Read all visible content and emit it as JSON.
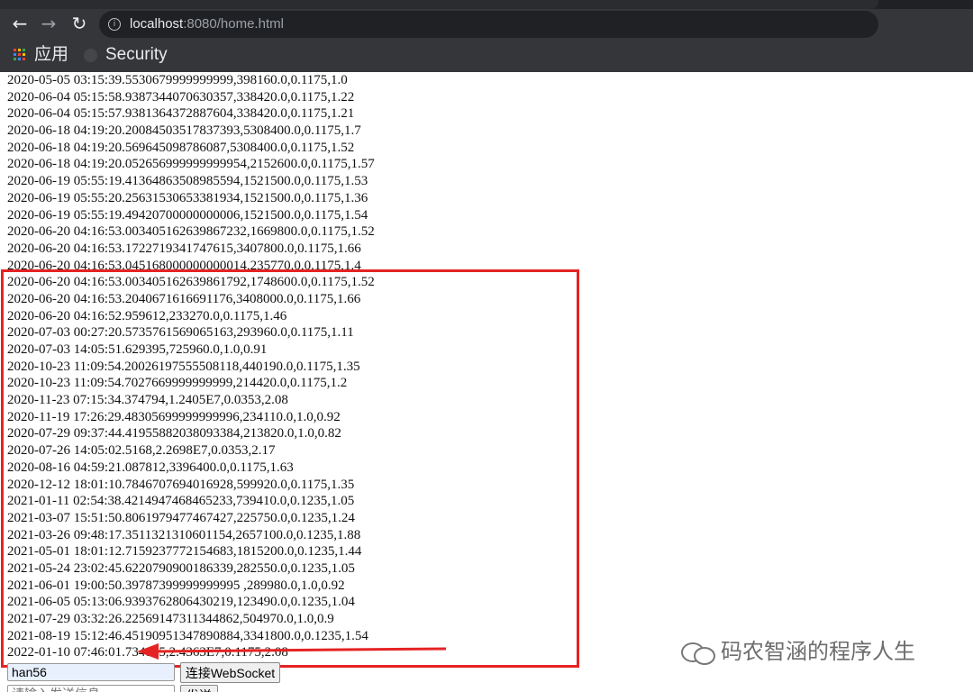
{
  "browser": {
    "url_host": "localhost",
    "url_rest": ":8080/home.html",
    "bookmarks": [
      {
        "label": "应用",
        "icon": "apps-grid-icon"
      },
      {
        "label": "Security",
        "icon": "github-icon"
      }
    ]
  },
  "log_lines": [
    "2020-05-05 03:15:39.5530679999999999,398160.0,0.1175,1.0",
    "2020-06-04 05:15:58.9387344070630357,338420.0,0.1175,1.22",
    "2020-06-04 05:15:57.9381364372887604,338420.0,0.1175,1.21",
    "2020-06-18 04:19:20.20084503517837393,5308400.0,0.1175,1.7",
    "2020-06-18 04:19:20.569645098786087,5308400.0,0.1175,1.52",
    "2020-06-18 04:19:20.052656999999999954,2152600.0,0.1175,1.57",
    "2020-06-19 05:55:19.41364863508985594,1521500.0,0.1175,1.53",
    "2020-06-19 05:55:20.25631530653381934,1521500.0,0.1175,1.36",
    "2020-06-19 05:55:19.49420700000000006,1521500.0,0.1175,1.54",
    "2020-06-20 04:16:53.003405162639867232,1669800.0,0.1175,1.52",
    "2020-06-20 04:16:53.1722719341747615,3407800.0,0.1175,1.66",
    "2020-06-20 04:16:53.045168000000000014,235770.0,0.1175,1.4",
    "2020-06-20 04:16:53.003405162639861792,1748600.0,0.1175,1.52",
    "2020-06-20 04:16:53.2040671616691176,3408000.0,0.1175,1.66",
    "2020-06-20 04:16:52.959612,233270.0,0.1175,1.46",
    "2020-07-03 00:27:20.5735761569065163,293960.0,0.1175,1.11",
    "2020-07-03 14:05:51.629395,725960.0,1.0,0.91",
    "2020-10-23 11:09:54.20026197555508118,440190.0,0.1175,1.35",
    "2020-10-23 11:09:54.7027669999999999,214420.0,0.1175,1.2",
    "2020-11-23 07:15:34.374794,1.2405E7,0.0353,2.08",
    "2020-11-19 17:26:29.48305699999999996,234110.0,1.0,0.92",
    "2020-07-29 09:37:44.41955882038093384,213820.0,1.0,0.82",
    "2020-07-26 14:05:02.5168,2.2698E7,0.0353,2.17",
    "2020-08-16 04:59:21.087812,3396400.0,0.1175,1.63",
    "2020-12-12 18:01:10.7846707694016928,599920.0,0.1175,1.35",
    "2021-01-11 02:54:38.4214947468465233,739410.0,0.1235,1.05",
    "2021-03-07 15:51:50.8061979477467427,225750.0,0.1235,1.24",
    "2021-03-26 09:48:17.3511321310601154,2657100.0,0.1235,1.88",
    "2021-05-01 18:01:12.7159237772154683,1815200.0,0.1235,1.44",
    "2021-05-24 23:02:45.6220790900186339,282550.0,0.1235,1.05",
    "2021-06-01 19:00:50.39787399999999995 ,289980.0,1.0,0.92",
    "2021-06-05 05:13:06.9393762806430219,123490.0,0.1235,1.04",
    "2021-07-29 03:32:26.22569147311344862,504970.0,1.0,0.9",
    "2021-08-19 15:12:46.45190951347890884,3341800.0,0.1235,1.54",
    "2022-01-10 07:46:01.734155,2.4363E7,0.1175,2.08"
  ],
  "controls": {
    "name_value": "han56",
    "connect_label": "连接WebSocket",
    "message_placeholder": "请输入发送信息",
    "send_label": "发送"
  },
  "watermark": "码农智涵的程序人生",
  "colors": {
    "highlight": "#e52323",
    "chrome_bg": "#35363a"
  }
}
